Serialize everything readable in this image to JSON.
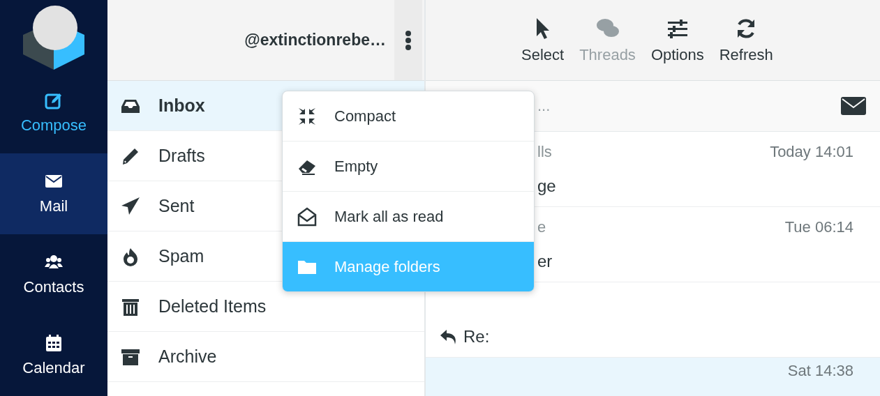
{
  "nav": [
    {
      "kind": "logo"
    },
    {
      "kind": "compose",
      "label": "Compose",
      "selected": false
    },
    {
      "kind": "mail",
      "label": "Mail",
      "selected": true
    },
    {
      "kind": "contacts",
      "label": "Contacts",
      "selected": false
    },
    {
      "kind": "calendar",
      "label": "Calendar",
      "selected": false
    }
  ],
  "account": {
    "name": "@extinctionrebe…"
  },
  "folders": [
    {
      "kind": "inbox",
      "label": "Inbox",
      "selected": true
    },
    {
      "kind": "drafts",
      "label": "Drafts",
      "selected": false
    },
    {
      "kind": "sent",
      "label": "Sent",
      "selected": false
    },
    {
      "kind": "spam",
      "label": "Spam",
      "selected": false
    },
    {
      "kind": "trash",
      "label": "Deleted Items",
      "selected": false
    },
    {
      "kind": "archive",
      "label": "Archive",
      "selected": false
    }
  ],
  "folder_menu": [
    {
      "kind": "compact",
      "label": "Compact",
      "selected": false
    },
    {
      "kind": "empty",
      "label": "Empty",
      "selected": false
    },
    {
      "kind": "read",
      "label": "Mark all as read",
      "selected": false
    },
    {
      "kind": "folders",
      "label": "Manage folders",
      "selected": true
    }
  ],
  "toolbar": [
    {
      "kind": "select",
      "label": "Select",
      "disabled": false
    },
    {
      "kind": "threads",
      "label": "Threads",
      "disabled": true
    },
    {
      "kind": "options",
      "label": "Options",
      "disabled": false
    },
    {
      "kind": "refresh",
      "label": "Refresh",
      "disabled": false
    }
  ],
  "search": {
    "placeholder": "..."
  },
  "messages": [
    {
      "from": "lls",
      "date": "Today 14:01",
      "subject": "ge",
      "replied": false,
      "selected": false
    },
    {
      "from": "e",
      "date": "Tue 06:14",
      "subject": "er",
      "replied": false,
      "selected": false
    },
    {
      "subject": "Re:",
      "replied": true,
      "selected": false
    },
    {
      "date": "Sat 14:38",
      "replied": false,
      "selected": true
    }
  ]
}
